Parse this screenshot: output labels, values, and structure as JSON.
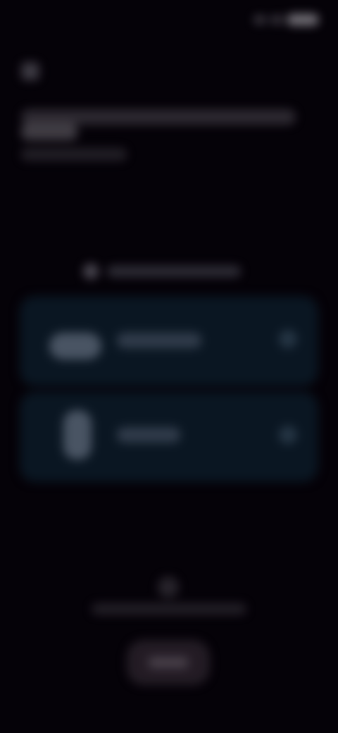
{
  "status_bar": {
    "time": "",
    "icons": [
      "signal-icon",
      "wifi-icon",
      "battery-icon"
    ]
  },
  "header": {
    "back_icon": "back-arrow-icon",
    "title": "",
    "subtitle": ""
  },
  "section": {
    "icon": "info-icon",
    "label": ""
  },
  "options": [
    {
      "icon": "cloud-icon",
      "label": ""
    },
    {
      "icon": "phone-icon",
      "label": ""
    }
  ],
  "footer": {
    "icon": "lock-icon",
    "text": "",
    "button_label": ""
  },
  "colors": {
    "background": "#050208",
    "card": "#0a1622"
  }
}
